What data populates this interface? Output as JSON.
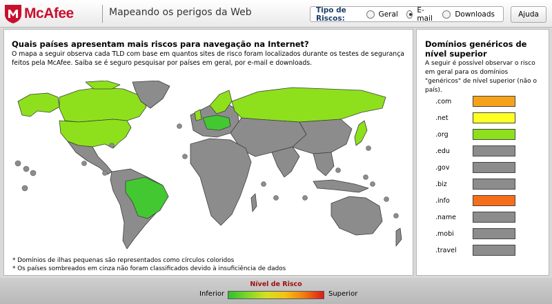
{
  "header": {
    "brand": "McAfee",
    "title": "Mapeando os perigos da Web",
    "risk_type": {
      "label": "Tipo de Riscos:",
      "options": [
        {
          "label": "Geral",
          "selected": false
        },
        {
          "label": "E-mail",
          "selected": true
        },
        {
          "label": "Downloads",
          "selected": false
        }
      ]
    },
    "help_label": "Ajuda"
  },
  "main": {
    "title": "Quais países apresentam mais riscos para navegação na Internet?",
    "description": "O mapa a seguir observa cada TLD com base em quantos sites de risco foram localizados durante os testes de segurança feitos pela McAfee. Saiba se é seguro pesquisar por países em geral, por e-mail e downloads.",
    "notes": [
      "* Domínios de ilhas pequenas são representados como círculos coloridos",
      "* Os países sombreados em cinza não foram classificados devido à insuficiência de dados"
    ]
  },
  "side": {
    "title": "Domínios genéricos de nível superior",
    "description": "A seguir é possível observar o risco em geral para os domínios \"genéricos\" de nível superior (não o  país).",
    "tlds": [
      {
        "name": ".com",
        "color": "#f5a21a"
      },
      {
        "name": ".net",
        "color": "#ffff22"
      },
      {
        "name": ".org",
        "color": "#8ee01c"
      },
      {
        "name": ".edu",
        "color": "#8c8c8c"
      },
      {
        "name": ".gov",
        "color": "#8c8c8c"
      },
      {
        "name": ".biz",
        "color": "#8c8c8c"
      },
      {
        "name": ".info",
        "color": "#f56f1a"
      },
      {
        "name": ".name",
        "color": "#8c8c8c"
      },
      {
        "name": ".mobi",
        "color": "#8c8c8c"
      },
      {
        "name": ".travel",
        "color": "#8c8c8c"
      }
    ]
  },
  "legend": {
    "title": "Nível de Risco",
    "low": "Inferior",
    "high": "Superior"
  },
  "colors": {
    "brand": "#c8102e",
    "unrated": "#8c8c8c",
    "low_risk": "#8ee01c",
    "lowest_risk": "#44c832"
  }
}
